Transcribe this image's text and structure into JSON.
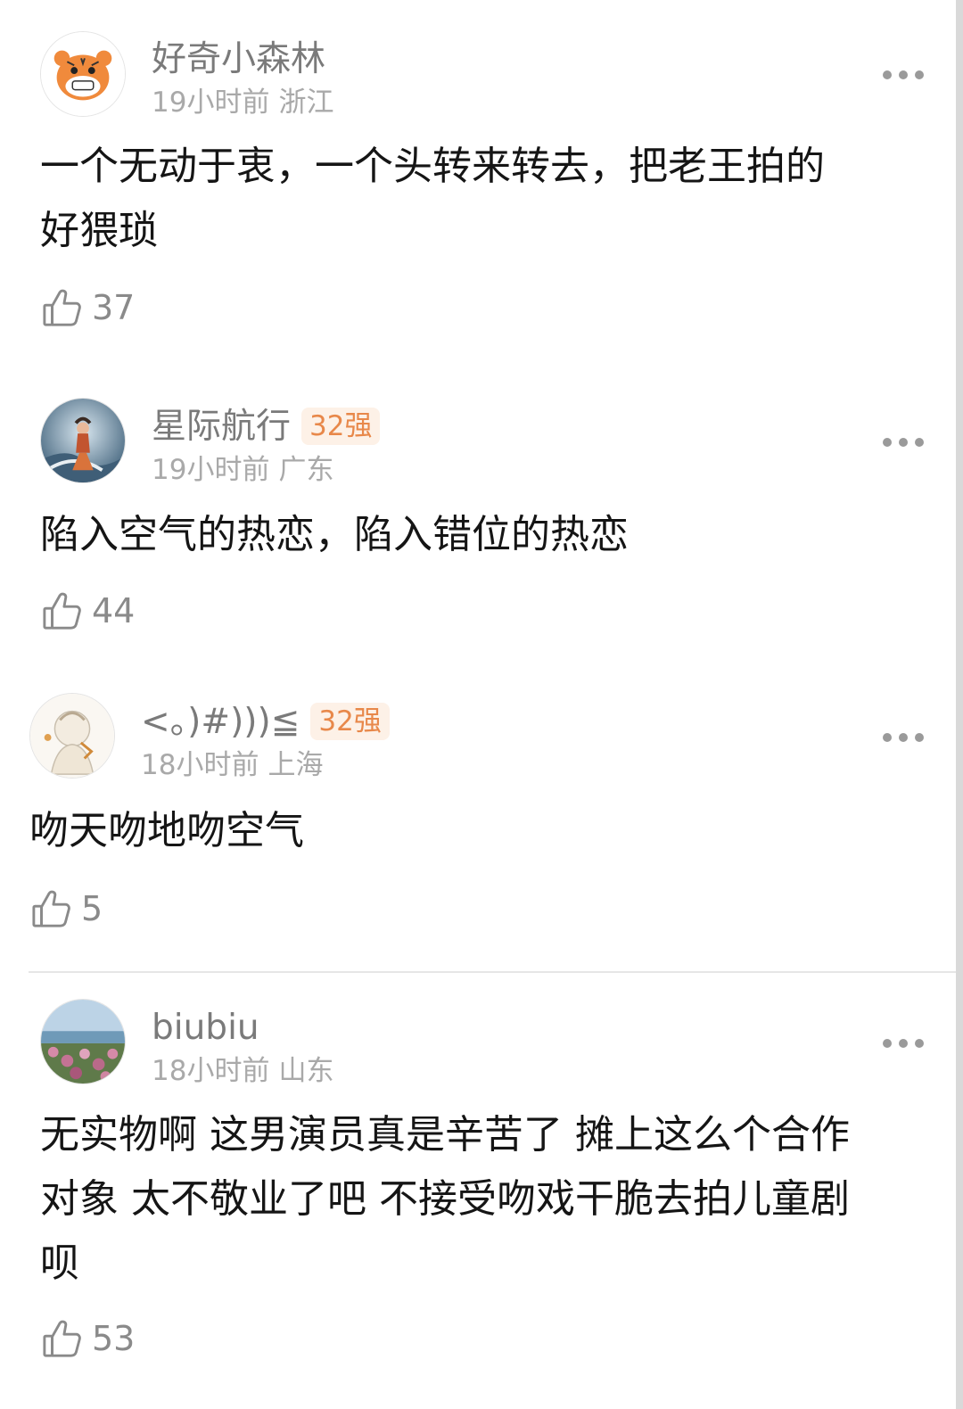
{
  "comments": [
    {
      "username": "好奇小森林",
      "badge": "",
      "time": "19小时前",
      "location": "浙江",
      "text": "一个无动于衷，一个头转来转去，把老王拍的\n好猥琐",
      "likes": "37",
      "avatar_icon": "tiger-avatar-icon"
    },
    {
      "username": "星际航行",
      "badge": "32强",
      "time": "19小时前",
      "location": "广东",
      "text": "陷入空气的热恋，陷入错位的热恋",
      "likes": "44",
      "avatar_icon": "fantasy-character-avatar-icon"
    },
    {
      "username": "<。)#)))≦",
      "badge": "32强",
      "time": "18小时前",
      "location": "上海",
      "text": "吻天吻地吻空气",
      "likes": "5",
      "avatar_icon": "anime-character-avatar-icon"
    },
    {
      "username": "biubiu",
      "badge": "",
      "time": "18小时前",
      "location": "山东",
      "text": "无实物啊 这男演员真是辛苦了 摊上这么个合作\n对象 太不敬业了吧 不接受吻戏干脆去拍儿童剧\n呗",
      "likes": "53",
      "avatar_icon": "seaside-flowers-avatar-icon"
    }
  ],
  "colors": {
    "username": "#7a7a7a",
    "meta": "#a9a9a9",
    "badge_text": "#e8884a",
    "badge_bg": "#fdf1e7"
  }
}
